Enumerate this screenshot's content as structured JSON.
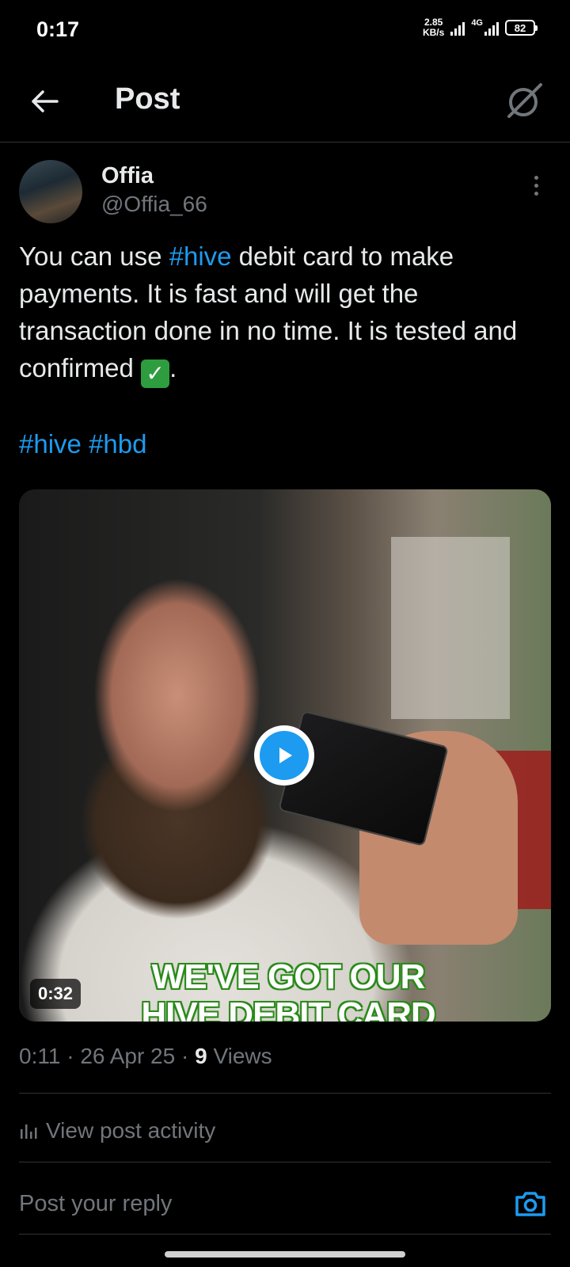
{
  "status_bar": {
    "time": "0:17",
    "net_speed_value": "2.85",
    "net_speed_unit": "KB/s",
    "network_type": "4G",
    "battery": "82"
  },
  "header": {
    "title": "Post",
    "back_icon": "arrow-left-icon",
    "grok_icon": "grok-icon"
  },
  "post": {
    "author": {
      "name": "Offia",
      "handle": "@Offia_66"
    },
    "text": {
      "part1": "You can use ",
      "hashtag1": "#hive",
      "part2": " debit card to make payments. It is fast and will get the transaction done in no time. It is tested and confirmed ",
      "emoji": "✓",
      "part3": "."
    },
    "tags": [
      "#hive",
      "#hbd"
    ],
    "media": {
      "duration": "0:32",
      "caption_line1": "WE'VE GOT OUR",
      "caption_line2": "HIVE DEBIT CARD"
    },
    "meta": {
      "time": "0:11",
      "separator": "·",
      "date": "26 Apr 25",
      "views_count": "9",
      "views_label": "Views"
    },
    "activity_label": "View post activity"
  },
  "reply": {
    "placeholder": "Post your reply"
  },
  "colors": {
    "background": "#000000",
    "accent": "#1d9bf0",
    "text_primary": "#e7e9ea",
    "text_secondary": "#71767b",
    "divider": "#2f3336"
  }
}
